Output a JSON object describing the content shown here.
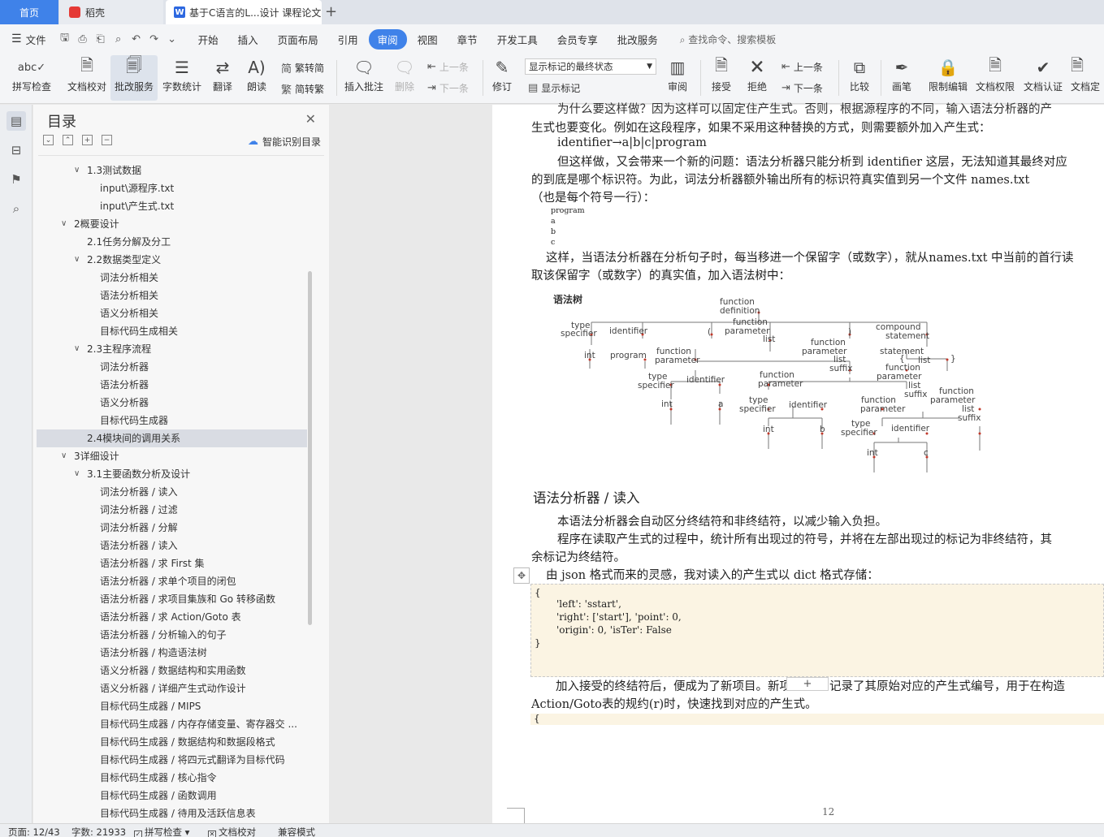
{
  "tabs": {
    "home": "首页",
    "daoke": "稻壳",
    "doc": "基于C语言的L...设计 课程论文",
    "add": "+"
  },
  "menu": {
    "file": "文件",
    "items": [
      "开始",
      "插入",
      "页面布局",
      "引用",
      "审阅",
      "视图",
      "章节",
      "开发工具",
      "会员专享",
      "批改服务"
    ],
    "active": "审阅",
    "search": "查找命令、搜索模板"
  },
  "ribbon": {
    "spell_check": "拼写检查",
    "doc_proof": "文档校对",
    "review_service": "批改服务",
    "word_count": "字数统计",
    "translate": "翻译",
    "read_aloud": "朗读",
    "trad_to_simp": "繁转简",
    "simp_to_trad": "简转繁",
    "insert_comment": "插入批注",
    "delete": "删除",
    "prev_comment": "上一条",
    "next_comment": "下一条",
    "track_changes": "修订",
    "markup_state": "显示标记的最终状态",
    "show_markup": "显示标记",
    "review_pane": "审阅",
    "accept": "接受",
    "reject": "拒绝",
    "prev_change": "上一条",
    "next_change": "下一条",
    "compare": "比较",
    "pen": "画笔",
    "restrict_edit": "限制编辑",
    "doc_permission": "文档权限",
    "doc_cert": "文档认证",
    "doc_final": "文档定"
  },
  "toc": {
    "title": "目录",
    "smart": "智能识别目录",
    "items": [
      {
        "text": "1.3测试数据",
        "level": 2,
        "arrow": "open"
      },
      {
        "text": "input\\源程序.txt",
        "level": 3,
        "arrow": ""
      },
      {
        "text": "input\\产生式.txt",
        "level": 3,
        "arrow": ""
      },
      {
        "text": "2概要设计",
        "level": 1,
        "arrow": "open"
      },
      {
        "text": "2.1任务分解及分工",
        "level": 2,
        "arrow": ""
      },
      {
        "text": "2.2数据类型定义",
        "level": 2,
        "arrow": "open"
      },
      {
        "text": "词法分析相关",
        "level": 3,
        "arrow": ""
      },
      {
        "text": "语法分析相关",
        "level": 3,
        "arrow": ""
      },
      {
        "text": "语义分析相关",
        "level": 3,
        "arrow": ""
      },
      {
        "text": "目标代码生成相关",
        "level": 3,
        "arrow": ""
      },
      {
        "text": "2.3主程序流程",
        "level": 2,
        "arrow": "open"
      },
      {
        "text": "词法分析器",
        "level": 3,
        "arrow": ""
      },
      {
        "text": "语法分析器",
        "level": 3,
        "arrow": ""
      },
      {
        "text": "语义分析器",
        "level": 3,
        "arrow": ""
      },
      {
        "text": "目标代码生成器",
        "level": 3,
        "arrow": ""
      },
      {
        "text": "2.4模块间的调用关系",
        "level": 2,
        "arrow": "",
        "selected": true
      },
      {
        "text": "3详细设计",
        "level": 1,
        "arrow": "open"
      },
      {
        "text": "3.1主要函数分析及设计",
        "level": 2,
        "arrow": "open"
      },
      {
        "text": "词法分析器 / 读入",
        "level": 3,
        "arrow": ""
      },
      {
        "text": "词法分析器 / 过滤",
        "level": 3,
        "arrow": ""
      },
      {
        "text": "词法分析器 / 分解",
        "level": 3,
        "arrow": ""
      },
      {
        "text": "语法分析器 / 读入",
        "level": 3,
        "arrow": ""
      },
      {
        "text": "语法分析器 / 求 First 集",
        "level": 3,
        "arrow": ""
      },
      {
        "text": "语法分析器 / 求单个项目的闭包",
        "level": 3,
        "arrow": ""
      },
      {
        "text": "语法分析器 / 求项目集族和 Go 转移函数",
        "level": 3,
        "arrow": ""
      },
      {
        "text": "语法分析器 / 求 Action/Goto 表",
        "level": 3,
        "arrow": ""
      },
      {
        "text": "语法分析器 / 分析输入的句子",
        "level": 3,
        "arrow": ""
      },
      {
        "text": "语法分析器 / 构造语法树",
        "level": 3,
        "arrow": ""
      },
      {
        "text": "语义分析器 / 数据结构和实用函数",
        "level": 3,
        "arrow": ""
      },
      {
        "text": "语义分析器 / 详细产生式动作设计",
        "level": 3,
        "arrow": ""
      },
      {
        "text": "目标代码生成器 / MIPS",
        "level": 3,
        "arrow": ""
      },
      {
        "text": "目标代码生成器 / 内存存储变量、寄存器交 ...",
        "level": 3,
        "arrow": ""
      },
      {
        "text": "目标代码生成器 / 数据结构和数据段格式",
        "level": 3,
        "arrow": ""
      },
      {
        "text": "目标代码生成器 / 将四元式翻译为目标代码",
        "level": 3,
        "arrow": ""
      },
      {
        "text": "目标代码生成器 / 核心指令",
        "level": 3,
        "arrow": ""
      },
      {
        "text": "目标代码生成器 / 函数调用",
        "level": 3,
        "arrow": ""
      },
      {
        "text": "目标代码生成器 / 待用及活跃信息表",
        "level": 3,
        "arrow": ""
      }
    ]
  },
  "document": {
    "line_top": "为什么要这样做？因为这样可以固定住产生式。否则，根据源程序的不同，输入语法分析器的产",
    "line1": "生式也要变化。例如在这段程序，如果不采用这种替换的方式，则需要额外加入产生式：",
    "line2": "identifier→a|b|c|program",
    "line3": "但这样做，又会带来一个新的问题：语法分析器只能分析到 identifier 这层，无法知道其最终对应",
    "line4": "的到底是哪个标识符。为此，词法分析器额外输出所有的标识符真实值到另一个文件 names.txt",
    "line5": "（也是每个符号一行）：",
    "names": [
      "program",
      "a",
      "b",
      "c"
    ],
    "line6": "这样，当语法分析器在分析句子时，每当移进一个保留字（或数字），就从names.txt 中当前的首行读",
    "line7": "取该保留字（或数字）的真实值，加入语法树中：",
    "tree_title": "语法树",
    "heading": "语法分析器 / 读入",
    "para1": "本语法分析器会自动区分终结符和非终结符，以减少输入负担。",
    "para2a": "程序在读取产生式的过程中，统计所有出现过的符号，并将在左部出现过的标记为非终结符，其",
    "para2b": "余标记为终结符。",
    "para3": "由 json 格式而来的灵感，我对读入的产生式以 dict 格式存储：",
    "code": [
      "{",
      "'left': 'sstart',",
      "'right': ['start'], 'point': 0,",
      "'origin': 0, 'isTer': False",
      "}"
    ],
    "para4a": "加入接受的终结符后，便成为了新项目。新项",
    "para4b": "记录了其原始对应的产生式编号，用于在构造",
    "para5": "Action/Goto表的规约(r)时，快速找到对应的产生式。",
    "code2": "{",
    "page_number": "12"
  },
  "tree_nodes": {
    "function_definition": [
      "function",
      "definition"
    ],
    "type_specifier": [
      "type",
      "specifier"
    ],
    "identifier": "identifier",
    "lparen": "(",
    "function_parameter_list": [
      "function",
      "parameter",
      "list"
    ],
    "rparen": ")",
    "compound_statement": [
      "compound",
      "statement"
    ],
    "int": "int",
    "program": "program",
    "function_parameter": [
      "function",
      "parameter"
    ],
    "function_parameter_list_suffix": [
      "function",
      "parameter",
      "list",
      "suffix"
    ],
    "statement_list": [
      "statement",
      "list"
    ],
    "brace_l": "{",
    "brace_r": "}",
    "a": "a",
    "b": "b",
    "c": "c",
    "comma": ","
  },
  "status": {
    "page": "页面: 12/43",
    "words": "字数: 21933",
    "spell": "拼写检查",
    "proof": "文档校对",
    "compat": "兼容模式"
  }
}
